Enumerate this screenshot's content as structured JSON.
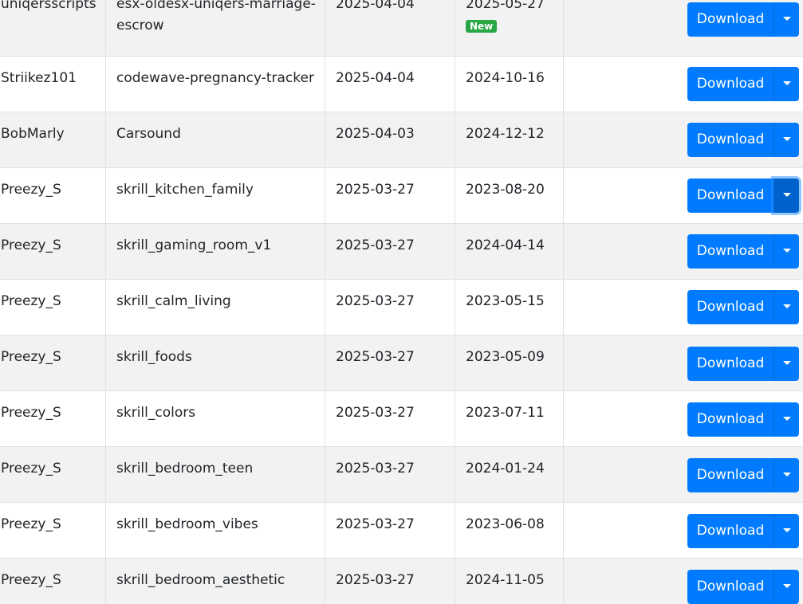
{
  "table": {
    "rows": [
      {
        "author": "uniqersscripts",
        "name": "esx-oldesx-uniqers-marriage-escrow",
        "added": "2025-04-04",
        "updated": "2025-05-27",
        "badge": "New",
        "download": "Download"
      },
      {
        "author": "Striikez101",
        "name": "codewave-pregnancy-tracker",
        "added": "2025-04-04",
        "updated": "2024-10-16",
        "download": "Download"
      },
      {
        "author": "BobMarly",
        "name": "Carsound",
        "added": "2025-04-03",
        "updated": "2024-12-12",
        "download": "Download"
      },
      {
        "author": "Preezy_S",
        "name": "skrill_kitchen_family",
        "added": "2025-03-27",
        "updated": "2023-08-20",
        "download": "Download"
      },
      {
        "author": "Preezy_S",
        "name": "skrill_gaming_room_v1",
        "added": "2025-03-27",
        "updated": "2024-04-14",
        "download": "Download"
      },
      {
        "author": "Preezy_S",
        "name": "skrill_calm_living",
        "added": "2025-03-27",
        "updated": "2023-05-15",
        "download": "Download"
      },
      {
        "author": "Preezy_S",
        "name": "skrill_foods",
        "added": "2025-03-27",
        "updated": "2023-05-09",
        "download": "Download"
      },
      {
        "author": "Preezy_S",
        "name": "skrill_colors",
        "added": "2025-03-27",
        "updated": "2023-07-11",
        "download": "Download"
      },
      {
        "author": "Preezy_S",
        "name": "skrill_bedroom_teen",
        "added": "2025-03-27",
        "updated": "2024-01-24",
        "download": "Download"
      },
      {
        "author": "Preezy_S",
        "name": "skrill_bedroom_vibes",
        "added": "2025-03-27",
        "updated": "2023-06-08",
        "download": "Download"
      },
      {
        "author": "Preezy_S",
        "name": "skrill_bedroom_aesthetic",
        "added": "2025-03-27",
        "updated": "2024-11-05",
        "download": "Download"
      }
    ]
  },
  "icons": {
    "dropdown": "caret-down-icon"
  },
  "colors": {
    "primary": "#007bff",
    "badge": "#28a745",
    "stripe": "#f2f2f2"
  }
}
